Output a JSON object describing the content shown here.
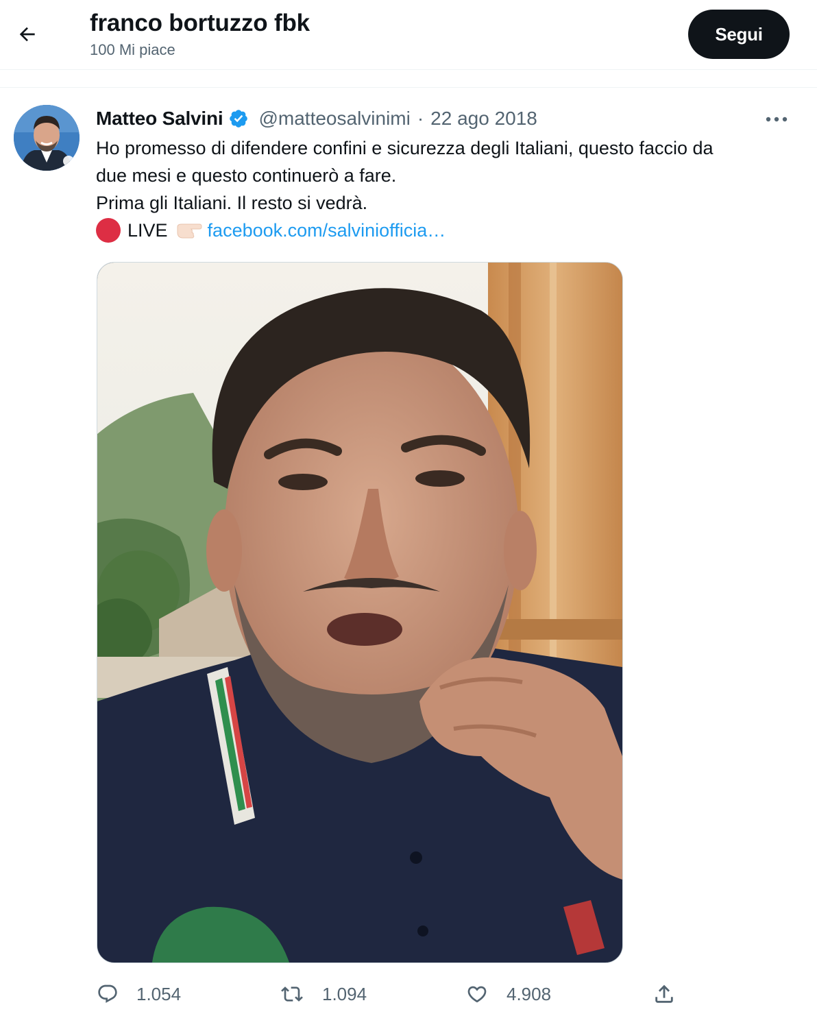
{
  "header": {
    "title": "franco bortuzzo fbk",
    "subtitle": "100 Mi piace",
    "follow_label": "Segui",
    "back_icon": "arrow-left-icon"
  },
  "tweet": {
    "author_name": "Matteo Salvini",
    "verified": true,
    "handle": "@matteosalvinimi",
    "separator": "·",
    "date": "22 ago 2018",
    "text_lines": [
      "Ho promesso di difendere confini e sicurezza degli Italiani, questo faccio da",
      "due mesi e questo continuerò a fare.",
      "Prima gli Italiani. Il resto si vedrà."
    ],
    "live_label": "LIVE",
    "link_text": "facebook.com/salviniofficia…",
    "icons": {
      "live": "red-circle-icon",
      "pointer": "backhand-index-pointing-right-icon",
      "more": "more-horizontal-icon",
      "verified": "verified-badge-icon"
    },
    "media": {
      "type": "video"
    },
    "actions": {
      "replies": "1.054",
      "retweets": "1.094",
      "likes": "4.908"
    }
  },
  "colors": {
    "text_primary": "#0f1419",
    "text_secondary": "#536471",
    "link": "#1d9bf0",
    "verified": "#1d9bf0",
    "follow_button_bg": "#0f1419",
    "live_dot": "#dd2e44",
    "divider": "#eff3f4"
  }
}
